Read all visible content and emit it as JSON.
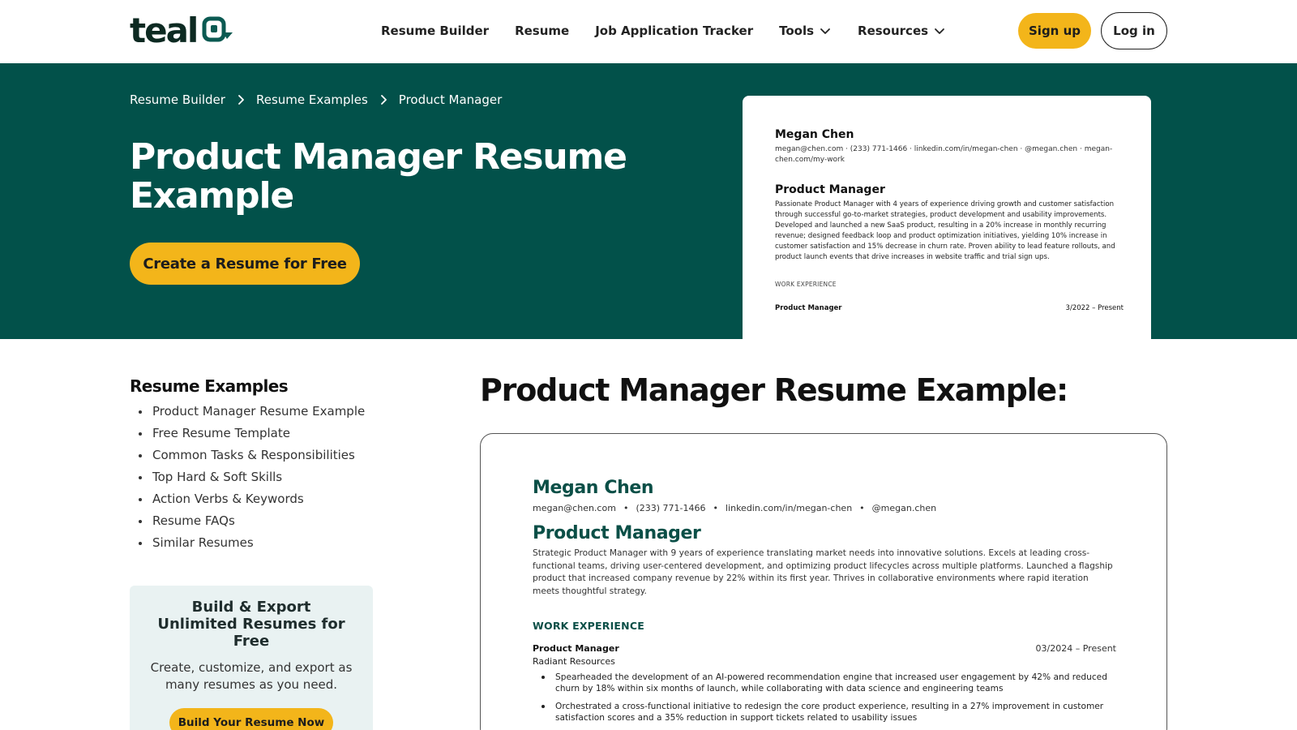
{
  "header": {
    "logo_text": "teal",
    "nav": [
      {
        "label": "Resume Builder"
      },
      {
        "label": "Resume"
      },
      {
        "label": "Job Application Tracker"
      },
      {
        "label": "Tools"
      },
      {
        "label": "Resources"
      }
    ],
    "signup_label": "Sign up",
    "login_label": "Log in"
  },
  "hero": {
    "breadcrumb": [
      "Resume Builder",
      "Resume Examples",
      "Product Manager"
    ],
    "title": "Product Manager Resume Example",
    "cta_label": "Create a Resume for Free",
    "preview": {
      "name": "Megan Chen",
      "contact": "megan@chen.com  ·  (233) 771-1466  ·  linkedin.com/in/megan-chen  ·  @megan.chen  ·  megan-chen.com/my-work",
      "title": "Product Manager",
      "summary": "Passionate Product Manager with 4 years of experience driving growth and customer satisfaction through successful go-to-market strategies, product development and usability improvements. Developed and launched a new SaaS product, resulting in a 20% increase in monthly recurring revenue; designed feedback loop and product optimization initiatives, yielding 10% increase in customer satisfaction and 15% decrease in churn rate. Proven ability to lead feature rollouts, and product launch events that drive increases in website traffic and trial sign ups.",
      "section": "WORK EXPERIENCE",
      "job_title": "Product Manager",
      "job_date": "3/2022 – Present"
    }
  },
  "sidebar": {
    "title": "Resume Examples",
    "items": [
      "Product Manager Resume Example",
      "Free Resume Template",
      "Common Tasks & Responsibilities",
      "Top Hard & Soft Skills",
      "Action Verbs & Keywords",
      "Resume FAQs",
      "Similar Resumes"
    ],
    "promo": {
      "title": "Build & Export Unlimited Resumes for Free",
      "desc": "Create, customize, and export as many resumes as you need.",
      "button": "Build Your Resume Now"
    }
  },
  "main": {
    "title": "Product Manager Resume Example:",
    "resume": {
      "name": "Megan Chen",
      "contact": [
        "megan@chen.com",
        "(233) 771-1466",
        "linkedin.com/in/megan-chen",
        "@megan.chen"
      ],
      "contact_sep": "•",
      "title": "Product Manager",
      "summary": "Strategic Product Manager with 9 years of experience translating market needs into innovative solutions. Excels at leading cross-functional teams, driving user-centered development, and optimizing product lifecycles across multiple platforms. Launched a flagship product that increased company revenue by 22% within its first year. Thrives in collaborative environments where rapid iteration meets thoughtful strategy.",
      "section": "WORK EXPERIENCE",
      "job_title": "Product Manager",
      "job_date": "03/2024 – Present",
      "company": "Radiant Resources",
      "bullets": [
        "Spearheaded the development of an AI-powered recommendation engine that increased user engagement by 42% and reduced churn by 18% within six months of launch, while collaborating with data science and engineering teams",
        "Orchestrated a cross-functional initiative to redesign the core product experience, resulting in a 27% improvement in customer satisfaction scores and a 35% reduction in support tickets related to usability issues"
      ]
    }
  },
  "colors": {
    "brand_green": "#02514a",
    "accent_yellow": "#f3b51a",
    "resume_heading": "#0b4f47"
  }
}
